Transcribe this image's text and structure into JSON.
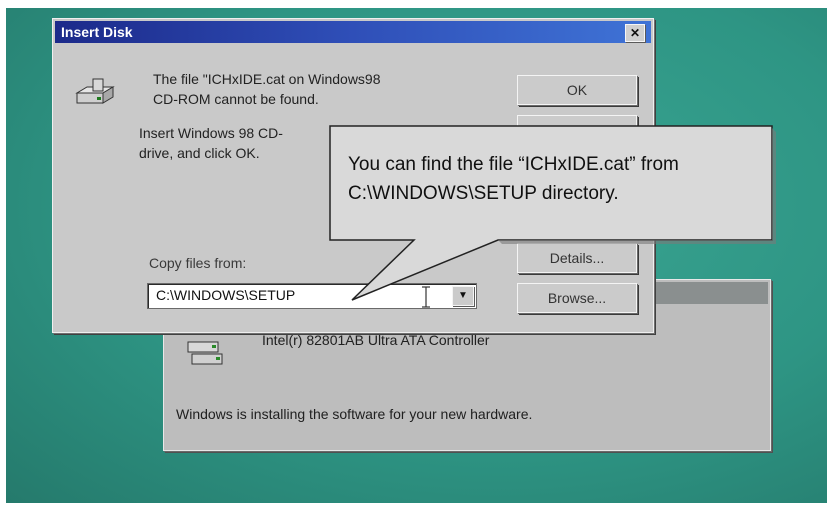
{
  "dialog": {
    "title": "Insert Disk",
    "close_glyph": "✕",
    "message_line1": "The file \"ICHxIDE.cat on Windows98",
    "message_line2": "CD-ROM cannot be found.",
    "instruction_line1": "Insert Windows 98 CD-",
    "instruction_line2": "drive, and click OK.",
    "ok_label": "OK",
    "details_label": "Details...",
    "browse_label": "Browse...",
    "copy_files_label": "Copy files from:",
    "copy_files_value": "C:\\WINDOWS\\SETUP",
    "combo_arrow_glyph": "▼",
    "icon": "disk-drive-icon"
  },
  "back_window": {
    "device_name": "Intel(r) 82801AB Ultra ATA Controller",
    "status_text": "Windows is installing the software for your new hardware.",
    "icon": "controller-icon"
  },
  "callout": {
    "line1": "You can find the file “ICHxIDE.cat” from",
    "line2": "C:\\WINDOWS\\SETUP directory."
  },
  "colors": {
    "desktop": "#2e9584",
    "titlebar_start": "#1c2a8a",
    "titlebar_end": "#3f73d6",
    "dialog_face": "#c9c9c9"
  }
}
